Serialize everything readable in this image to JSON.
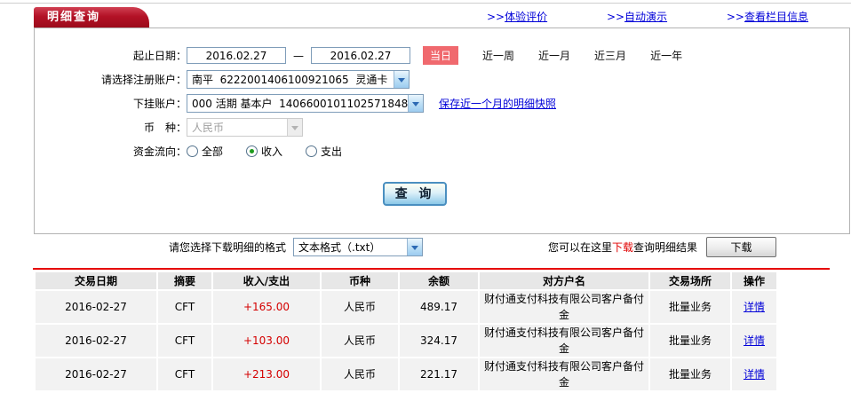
{
  "module": {
    "tab_title": "明细查询"
  },
  "top_links": [
    {
      "prefix": ">>",
      "label": "体验评价"
    },
    {
      "prefix": ">>",
      "label": "自动演示"
    },
    {
      "prefix": ">>",
      "label": "查看栏目信息"
    }
  ],
  "form": {
    "date_label": "起止日期：",
    "date_from": "2016.02.27",
    "date_separator": "—",
    "date_to": "2016.02.27",
    "today_badge": "当日",
    "quick_ranges": [
      "近一周",
      "近一月",
      "近三月",
      "近一年"
    ],
    "register_account_label": "请选择注册账户：",
    "register_account_value": "南平  6222001406100921065  灵通卡",
    "sub_account_label": "下挂账户：",
    "sub_account_value": "000 活期 基本户  1406600101102571848",
    "snapshot_link": "保存近一个月的明细快照",
    "currency_label": "币　种：",
    "currency_value": "人民币",
    "flow_label": "资金流向：",
    "flow_options": [
      {
        "label": "全部",
        "selected": false
      },
      {
        "label": "收入",
        "selected": true
      },
      {
        "label": "支出",
        "selected": false
      }
    ],
    "query_button": "查 询"
  },
  "download": {
    "format_label": "请您选择下载明细的格式",
    "format_value": "文本格式（.txt）",
    "hint_prefix": "您可以在这里",
    "hint_red": "下载",
    "hint_suffix": "查询明细结果",
    "download_button": "下载"
  },
  "table": {
    "headers": [
      "交易日期",
      "摘要",
      "收入/支出",
      "币种",
      "余额",
      "对方户名",
      "交易场所",
      "操作"
    ],
    "rows": [
      {
        "date": "2016-02-27",
        "summary": "CFT",
        "amount": "+165.00",
        "currency": "人民币",
        "balance": "489.17",
        "counterparty": "财付通支付科技有限公司客户备付金",
        "venue": "批量业务",
        "action": "详情"
      },
      {
        "date": "2016-02-27",
        "summary": "CFT",
        "amount": "+103.00",
        "currency": "人民币",
        "balance": "324.17",
        "counterparty": "财付通支付科技有限公司客户备付金",
        "venue": "批量业务",
        "action": "详情"
      },
      {
        "date": "2016-02-27",
        "summary": "CFT",
        "amount": "+213.00",
        "currency": "人民币",
        "balance": "221.17",
        "counterparty": "财付通支付科技有限公司客户备付金",
        "venue": "批量业务",
        "action": "详情"
      }
    ]
  },
  "colors": {
    "tab_red": "#b31226",
    "today_badge_bg": "#f0696e",
    "link_blue": "#0000d8",
    "amount_red": "#d40000",
    "separator_red": "#e60000",
    "table_header_bg": "#e7e7e7",
    "table_row_bg": "#f2f2f2"
  }
}
